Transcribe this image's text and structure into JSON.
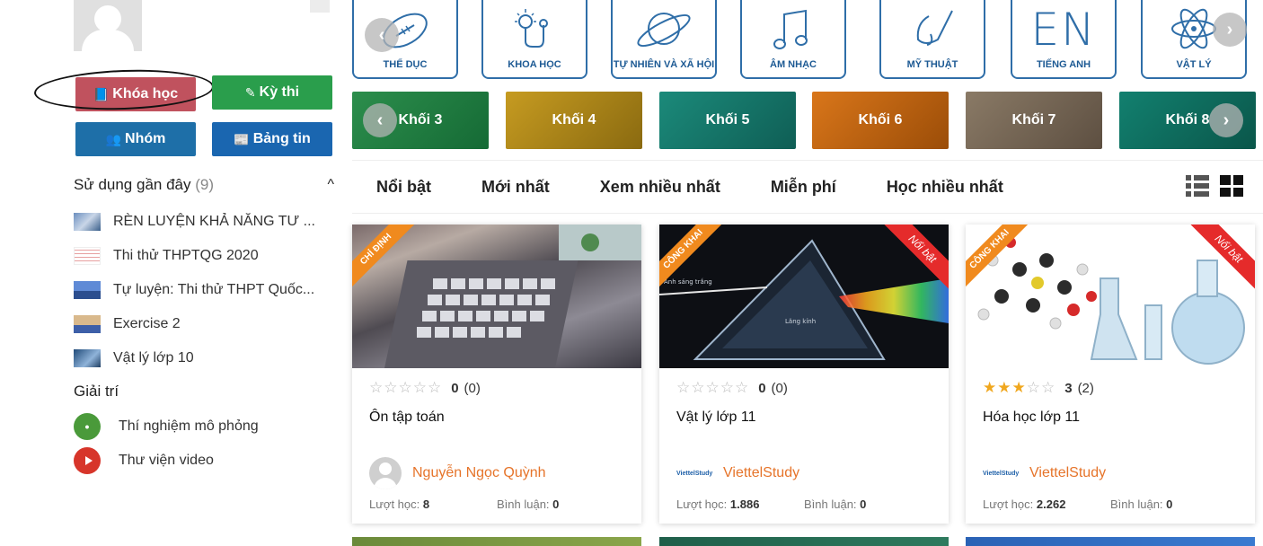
{
  "sidebar": {
    "buttons": {
      "courses": "Khóa học",
      "exam": "Kỳ thi",
      "group": "Nhóm",
      "news": "Bảng tin"
    },
    "recent": {
      "title": "Sử dụng gần đây",
      "count": "(9)",
      "items": [
        "RÈN LUYỆN KHẢ NĂNG TƯ ...",
        "Thi thử THPTQG 2020",
        "Tự luyện: Thi thử THPT Quốc...",
        "Exercise 2",
        "Vật lý lớp 10"
      ]
    },
    "entertainment": {
      "title": "Giải trí",
      "items": [
        "Thí nghiệm mô phỏng",
        "Thư viện video"
      ]
    }
  },
  "subjects": [
    {
      "label": "THỂ DỤC",
      "icon": "football-icon"
    },
    {
      "label": "KHOA HỌC",
      "icon": "bulb-icon"
    },
    {
      "label": "TỰ NHIÊN VÀ XÃ HỘI",
      "icon": "planet-icon"
    },
    {
      "label": "ÂM NHẠC",
      "icon": "music-note-icon"
    },
    {
      "label": "MỸ THUẬT",
      "icon": "paintbrush-icon"
    },
    {
      "label": "TIẾNG ANH",
      "icon": "en-icon",
      "big": "EN"
    },
    {
      "label": "VẬT LÝ",
      "icon": "atom-icon"
    }
  ],
  "grades": [
    "Khối 3",
    "Khối 4",
    "Khối 5",
    "Khối 6",
    "Khối 7",
    "Khối 8"
  ],
  "filters": [
    "Nổi bật",
    "Mới nhất",
    "Xem nhiều nhất",
    "Miễn phí",
    "Học nhiều nhất"
  ],
  "cards": [
    {
      "ribbon": "CHỈ ĐỊNH",
      "badge": "",
      "rating": "0",
      "reviews": "(0)",
      "stars": 0,
      "title": "Ôn tập toán",
      "author": "Nguyễn Ngọc Quỳnh",
      "learn_label": "Lượt học:",
      "learn": "8",
      "comment_label": "Bình luận:",
      "comments": "0"
    },
    {
      "ribbon": "CÔNG KHAI",
      "badge": "Nổi bật",
      "rating": "0",
      "reviews": "(0)",
      "stars": 0,
      "title": "Vật lý lớp 11",
      "author": "ViettelStudy",
      "learn_label": "Lượt học:",
      "learn": "1.886",
      "comment_label": "Bình luận:",
      "comments": "0",
      "img_text_1": "Ánh sáng trắng",
      "img_text_2": "Lăng kính"
    },
    {
      "ribbon": "CÔNG KHAI",
      "badge": "Nổi bật",
      "rating": "3",
      "reviews": "(2)",
      "stars": 3,
      "title": "Hóa học lớp 11",
      "author": "ViettelStudy",
      "learn_label": "Lượt học:",
      "learn": "2.262",
      "comment_label": "Bình luận:",
      "comments": "0"
    }
  ],
  "colors": {
    "accent_orange": "#e6742a",
    "subject_blue": "#2f6ea8",
    "courses_btn": "#c0525e",
    "exam_btn": "#2a9e4c"
  }
}
